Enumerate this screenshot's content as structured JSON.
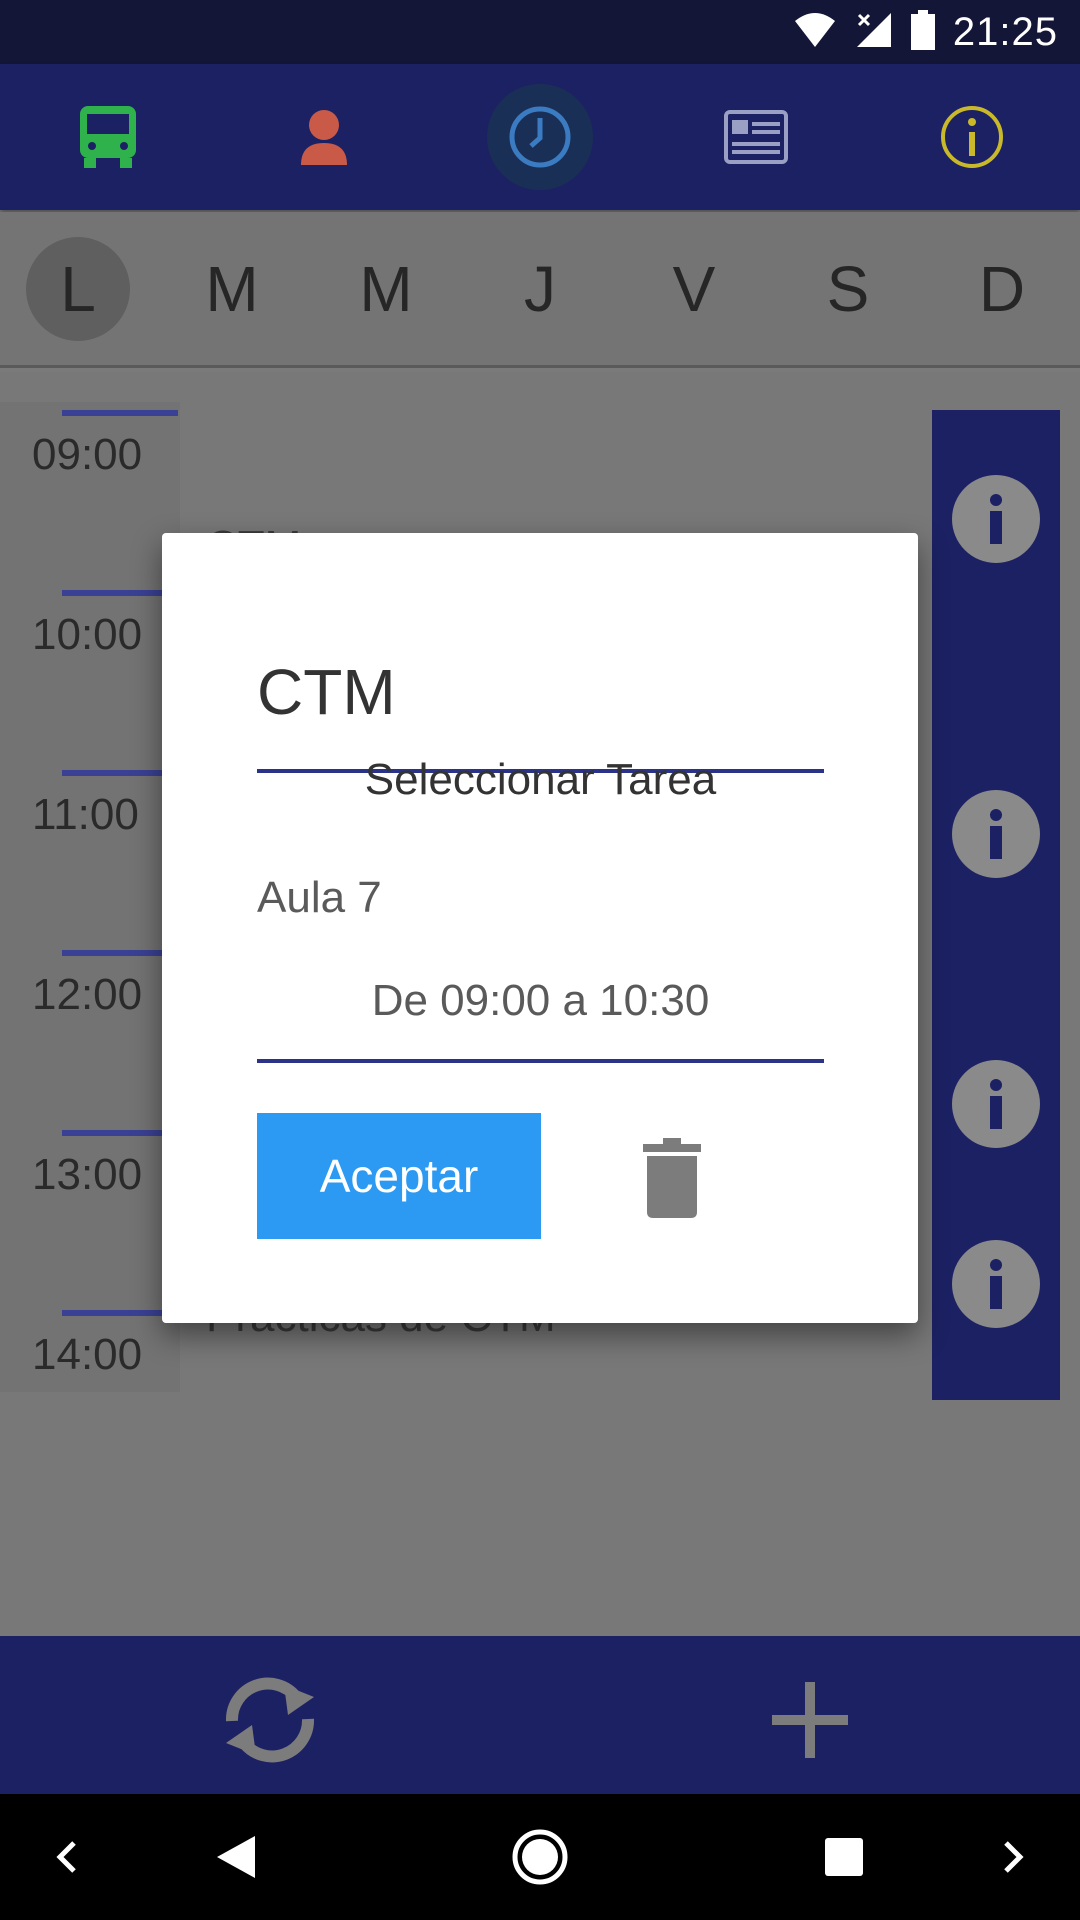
{
  "status_bar": {
    "time": "21:25"
  },
  "top_nav": {
    "items": [
      {
        "icon": "bus-icon",
        "color": "#2fb24c"
      },
      {
        "icon": "person-icon",
        "color": "#c85a47"
      },
      {
        "icon": "clock-icon",
        "color": "#3b7bc2"
      },
      {
        "icon": "id-card-icon",
        "color": "#9aa0c4"
      },
      {
        "icon": "info-icon",
        "color": "#c8b82a"
      }
    ]
  },
  "days": [
    "L",
    "M",
    "M",
    "J",
    "V",
    "S",
    "D"
  ],
  "selected_day_index": 0,
  "schedule": {
    "slots": [
      "09:00",
      "10:00",
      "11:00",
      "12:00",
      "13:00",
      "14:00"
    ],
    "obscured_texts": [
      "CTM",
      "Prácticas de CTM"
    ]
  },
  "dialog": {
    "title": "CTM",
    "subtitle": "Seleccionar Tarea",
    "room": "Aula 7",
    "time_range": "De 09:00 a 10:30",
    "accept_label": "Aceptar"
  },
  "colors": {
    "primary": "#1c2163",
    "accent": "#2c9af2",
    "underline": "#2b3388"
  }
}
